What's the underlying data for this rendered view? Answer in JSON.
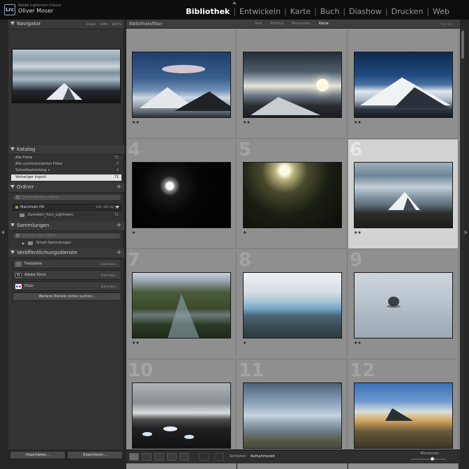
{
  "app": {
    "logo_text": "Lrc",
    "product": "Adobe Lightroom Classic",
    "user": "Oliver Moser"
  },
  "modules": [
    "Bibliothek",
    "Entwickeln",
    "Karte",
    "Buch",
    "Diashow",
    "Drucken",
    "Web"
  ],
  "active_module": "Bibliothek",
  "navigator": {
    "title": "Navigator",
    "zoom": [
      "Einpas.",
      "100%",
      "28,5 %"
    ]
  },
  "catalog": {
    "title": "Katalog",
    "items": [
      {
        "label": "Alle Fotos",
        "count": "71"
      },
      {
        "label": "Alle synchronisierten Fotos",
        "count": "0"
      },
      {
        "label": "Schnellsammlung +",
        "count": "0"
      },
      {
        "label": "Vorheriger Import",
        "count": "71"
      }
    ]
  },
  "folders": {
    "title": "Ordner",
    "search_placeholder": "Ordnerstruktur filtern",
    "volume": {
      "label": "Macintosh HD",
      "capacity": "308 / 465 GB"
    },
    "items": [
      {
        "label": "Zumstein_Kurs_Lightroom",
        "count": "71"
      }
    ]
  },
  "collections": {
    "title": "Sammlungen",
    "search_placeholder": "Sammlungen filtern",
    "items": [
      {
        "label": "Smart-Sammlungen"
      }
    ]
  },
  "publish": {
    "title": "Veröffentlichungsdienste",
    "services": [
      {
        "label": "Festplatte",
        "action": "Einrichten..."
      },
      {
        "label": "Adobe Stock",
        "action": "Einrichten..."
      },
      {
        "label": "Flickr",
        "action": "Einrichten..."
      }
    ],
    "more_button": "Weitere Dienste online suchen..."
  },
  "left_buttons": {
    "import": "Importieren...",
    "export": "Exportieren..."
  },
  "filterbar": {
    "title": "Bibliotheksfilter:",
    "tabs": [
      "Text",
      "Attribut",
      "Metadaten",
      "Keine"
    ],
    "active_tab": "Keine",
    "filter_state": "Filter aus"
  },
  "photos": [
    {
      "index": "",
      "stars": "★★"
    },
    {
      "index": "",
      "stars": "★★"
    },
    {
      "index": "",
      "stars": "★★"
    },
    {
      "index": "4",
      "stars": "★"
    },
    {
      "index": "5",
      "stars": "★"
    },
    {
      "index": "6",
      "stars": "★★"
    },
    {
      "index": "7",
      "stars": "★★"
    },
    {
      "index": "8",
      "stars": "★"
    },
    {
      "index": "9",
      "stars": "★★"
    },
    {
      "index": "10",
      "stars": "★"
    },
    {
      "index": "11",
      "stars": "★"
    },
    {
      "index": "12",
      "stars": "★"
    }
  ],
  "selected_photo": 6,
  "toolbar": {
    "sort_label": "Sortieren:",
    "sort_value": "Aufnahmezeit",
    "thumbnail_label": "Miniaturen"
  },
  "colors": {
    "accent_selected_cell": "#d2d2d2",
    "grid_bg": "#8f8f8f",
    "panel_bg": "#333333"
  }
}
